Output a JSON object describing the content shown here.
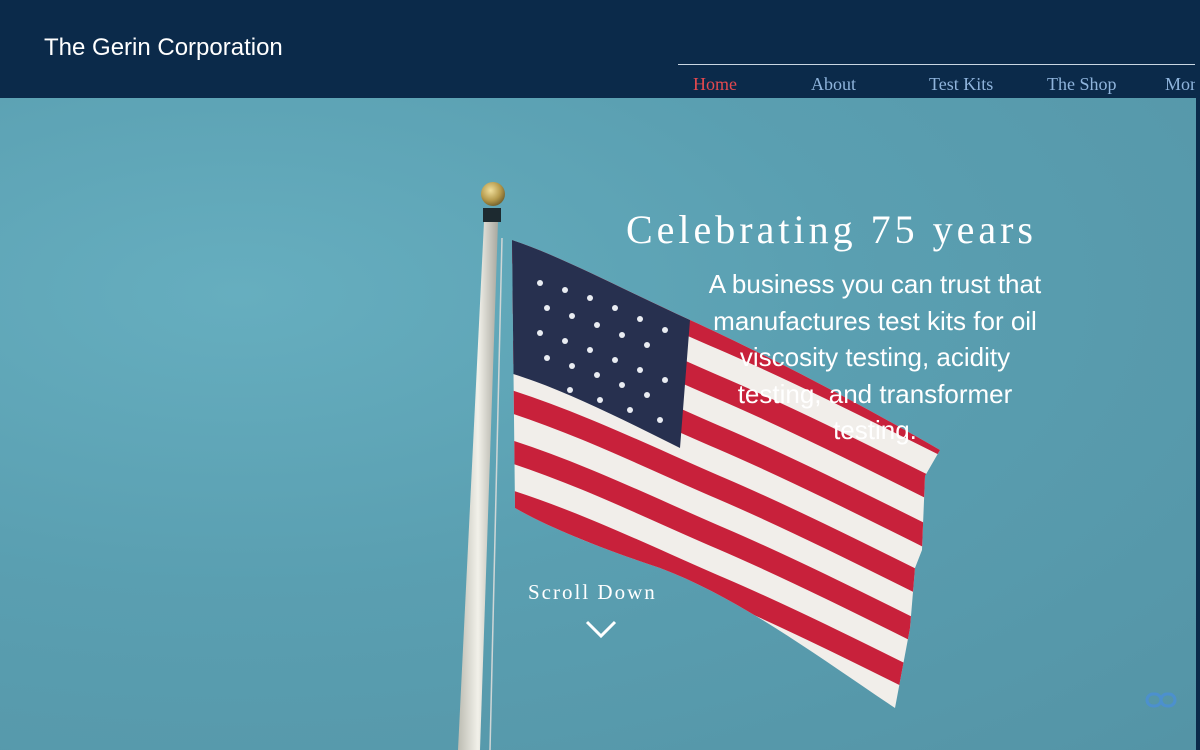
{
  "header": {
    "site_title": "The Gerin Corporation"
  },
  "nav": {
    "items": [
      {
        "label": "Home",
        "active": true
      },
      {
        "label": "About",
        "active": false
      },
      {
        "label": "Test Kits",
        "active": false
      },
      {
        "label": "The Shop",
        "active": false
      },
      {
        "label": "More",
        "active": false
      }
    ]
  },
  "hero": {
    "headline": "Celebrating 75 years",
    "tagline": "A business you can trust that manufactures test kits for oil viscosity testing, acidity testing, and transformer testing.",
    "scroll_label": "Scroll Down",
    "scroll_icon": "chevron-down-icon",
    "corner_icon": "link-icon"
  },
  "colors": {
    "header_bg": "#0b2a4a",
    "nav_active": "#e5494f",
    "nav_link": "#8fb4dc",
    "sky": "#5a9fb0",
    "flag_red": "#c8213b",
    "flag_blue": "#27304f"
  }
}
